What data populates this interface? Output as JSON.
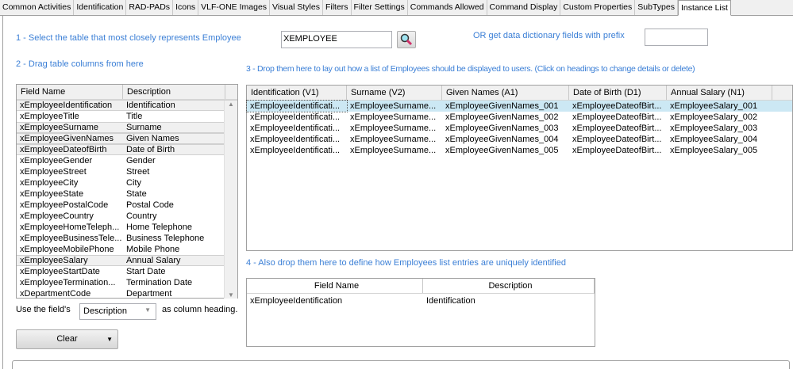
{
  "tabs": [
    "Common Activities",
    "Identification",
    "RAD-PADs",
    "Icons",
    "VLF-ONE Images",
    "Visual Styles",
    "Filters",
    "Filter Settings",
    "Commands Allowed",
    "Command Display",
    "Custom Properties",
    "SubTypes",
    "Instance List"
  ],
  "active_tab": "Instance List",
  "step1": {
    "label": "1 - Select the table that most closely represents Employee",
    "table_value": "XEMPLOYEE",
    "search_icon": "magnifier-icon"
  },
  "prefix": {
    "label": "OR get data dictionary fields with prefix",
    "value": ""
  },
  "step2": {
    "label": "2 - Drag table columns from here"
  },
  "fields_grid": {
    "headers": [
      "Field Name",
      "Description"
    ],
    "rows": [
      [
        "xEmployeeIdentification",
        "Identification",
        true
      ],
      [
        "xEmployeeTitle",
        "Title",
        false
      ],
      [
        "xEmployeeSurname",
        "Surname",
        true
      ],
      [
        "xEmployeeGivenNames",
        "Given Names",
        true
      ],
      [
        "xEmployeeDateofBirth",
        "Date of Birth",
        true
      ],
      [
        "xEmployeeGender",
        "Gender",
        false
      ],
      [
        "xEmployeeStreet",
        "Street",
        false
      ],
      [
        "xEmployeeCity",
        "City",
        false
      ],
      [
        "xEmployeeState",
        "State",
        false
      ],
      [
        "xEmployeePostalCode",
        "Postal Code",
        false
      ],
      [
        "xEmployeeCountry",
        "Country",
        false
      ],
      [
        "xEmployeeHomeTeleph...",
        "Home Telephone",
        false
      ],
      [
        "xEmployeeBusinessTele...",
        "Business Telephone",
        false
      ],
      [
        "xEmployeeMobilePhone",
        "Mobile Phone",
        false
      ],
      [
        "xEmployeeSalary",
        "Annual Salary",
        true
      ],
      [
        "xEmployeeStartDate",
        "Start Date",
        false
      ],
      [
        "xEmployeeTermination...",
        "Termination Date",
        false
      ],
      [
        "xDepartmentCode",
        "Department",
        false
      ]
    ]
  },
  "heading_option": {
    "prefix": "Use the field's",
    "value": "Description",
    "suffix": "as column heading."
  },
  "clear_button": "Clear",
  "step3": {
    "label": "3 - Drop them here to lay out how a list of Employees should be displayed to users. (Click on headings to change details or delete)"
  },
  "list_grid": {
    "headers": [
      "Identification (V1)",
      "Surname (V2)",
      "Given Names (A1)",
      "Date of Birth (D1)",
      "Annual Salary (N1)"
    ],
    "rows": [
      [
        "xEmployeeIdentificati...",
        "xEmployeeSurname...",
        "xEmployeeGivenNames_001",
        "xEmployeeDateofBirt...",
        "xEmployeeSalary_001"
      ],
      [
        "xEmployeeIdentificati...",
        "xEmployeeSurname...",
        "xEmployeeGivenNames_002",
        "xEmployeeDateofBirt...",
        "xEmployeeSalary_002"
      ],
      [
        "xEmployeeIdentificati...",
        "xEmployeeSurname...",
        "xEmployeeGivenNames_003",
        "xEmployeeDateofBirt...",
        "xEmployeeSalary_003"
      ],
      [
        "xEmployeeIdentificati...",
        "xEmployeeSurname...",
        "xEmployeeGivenNames_004",
        "xEmployeeDateofBirt...",
        "xEmployeeSalary_004"
      ],
      [
        "xEmployeeIdentificati...",
        "xEmployeeSurname...",
        "xEmployeeGivenNames_005",
        "xEmployeeDateofBirt...",
        "xEmployeeSalary_005"
      ]
    ]
  },
  "step4": {
    "label": "4 - Also drop them here to define how Employees list entries are uniquely identified"
  },
  "key_grid": {
    "headers": [
      "Field Name",
      "Description"
    ],
    "rows": [
      [
        "xEmployeeIdentification",
        "Identification"
      ]
    ]
  },
  "colors": {
    "label_blue": "#3b7fd6",
    "selection": "#cce8f4"
  }
}
